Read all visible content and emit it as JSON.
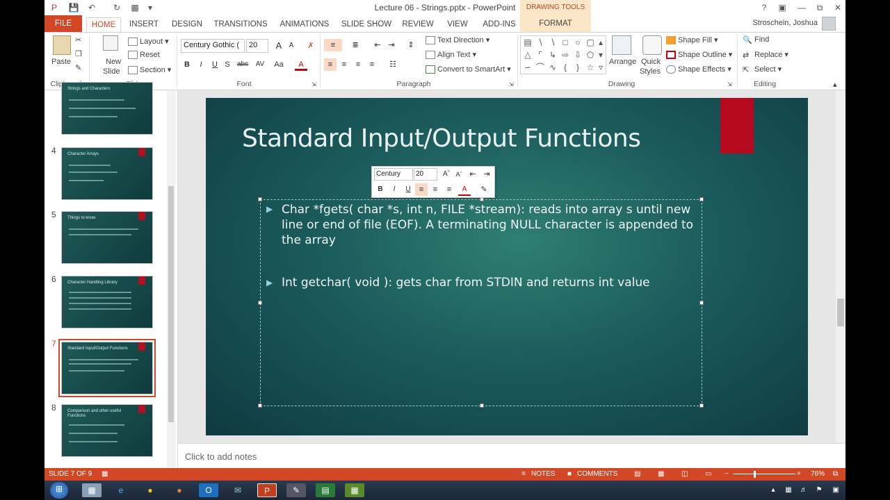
{
  "window": {
    "title": "Lecture 06 - Strings.pptx - PowerPoint",
    "contextual_tab_group": "DRAWING TOOLS",
    "help": "?",
    "user": "Stroschein, Joshua"
  },
  "tabs": [
    "FILE",
    "HOME",
    "INSERT",
    "DESIGN",
    "TRANSITIONS",
    "ANIMATIONS",
    "SLIDE SHOW",
    "REVIEW",
    "VIEW",
    "ADD-INS",
    "FORMAT"
  ],
  "ribbon": {
    "clipboard": {
      "paste": "Paste",
      "label": "Clipboard"
    },
    "slides": {
      "new_slide_1": "New",
      "new_slide_2": "Slide",
      "layout": "Layout",
      "reset": "Reset",
      "section": "Section",
      "label": "Slides"
    },
    "font": {
      "family": "Century Gothic (",
      "size": "20",
      "bold": "B",
      "italic": "I",
      "underline": "U",
      "strike": "abc",
      "spacing": "AV",
      "case": "Aa",
      "color": "A",
      "grow": "A",
      "shrink": "A",
      "label": "Font"
    },
    "paragraph": {
      "text_direction": "Text Direction",
      "align_text": "Align Text",
      "convert_smartart": "Convert to SmartArt",
      "label": "Paragraph"
    },
    "drawing": {
      "arrange": "Arrange",
      "quick_styles_1": "Quick",
      "quick_styles_2": "Styles",
      "shape_fill": "Shape Fill",
      "shape_outline": "Shape Outline",
      "shape_effects": "Shape Effects",
      "label": "Drawing"
    },
    "editing": {
      "find": "Find",
      "replace": "Replace",
      "select": "Select",
      "label": "Editing"
    }
  },
  "thumbnails": [
    {
      "num": "",
      "title": "Strings and Characters"
    },
    {
      "num": "4",
      "title": "Character Arrays"
    },
    {
      "num": "5",
      "title": "Things to know"
    },
    {
      "num": "6",
      "title": "Character Handling Library"
    },
    {
      "num": "7",
      "title": "Standard Input/Output Functions"
    },
    {
      "num": "8",
      "title": "Comparison and other useful Functions"
    }
  ],
  "slide": {
    "title": "Standard Input/Output Functions",
    "bullet_1": "Char *fgets( char *s, int n, FILE *stream): reads into array s until new line or end of file (EOF). A terminating NULL character is appended to the array",
    "bullet_2": "Int getchar( void ): gets char from STDIN and returns int value"
  },
  "mini_toolbar": {
    "font": "Century",
    "size": "20",
    "bold": "B",
    "italic": "I",
    "underline": "U"
  },
  "notes_placeholder": "Click to add notes",
  "status": {
    "slide": "SLIDE 7 OF 9",
    "notes": "NOTES",
    "comments": "COMMENTS",
    "zoom": "76%"
  },
  "colors": {
    "accent": "#d24726",
    "slide_bg": "#1b5b5c",
    "slide_red": "#b50a1e"
  }
}
